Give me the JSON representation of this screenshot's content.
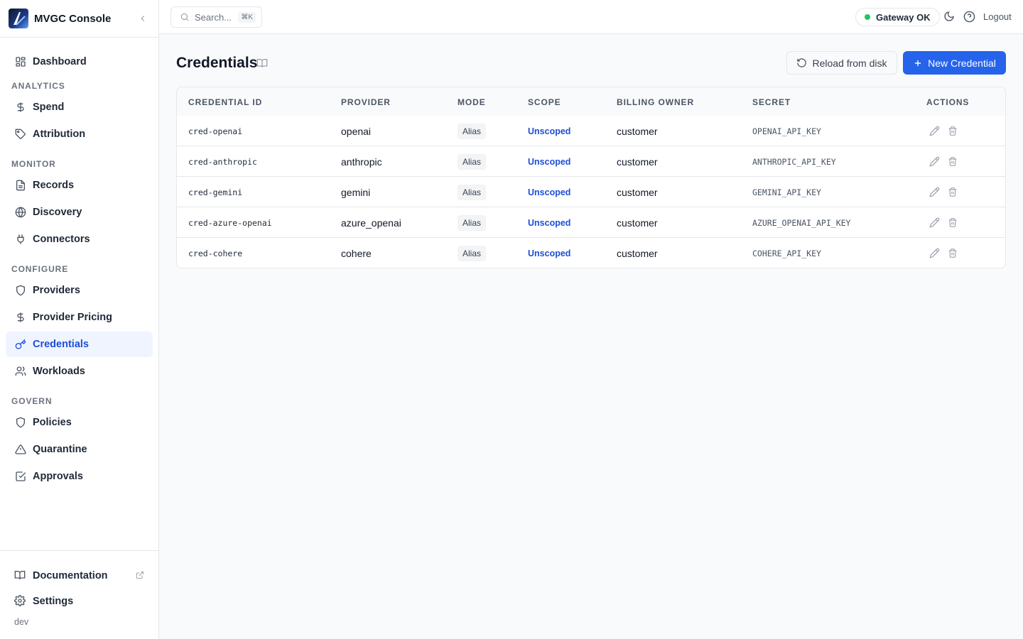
{
  "app": {
    "title": "MVGC Console"
  },
  "sidebar": {
    "dashboard": "Dashboard",
    "sections": {
      "analytics": "ANALYTICS",
      "monitor": "MONITOR",
      "configure": "CONFIGURE",
      "govern": "GOVERN"
    },
    "items": {
      "spend": "Spend",
      "attribution": "Attribution",
      "records": "Records",
      "discovery": "Discovery",
      "connectors": "Connectors",
      "providers": "Providers",
      "provider_pricing": "Provider Pricing",
      "credentials": "Credentials",
      "workloads": "Workloads",
      "policies": "Policies",
      "quarantine": "Quarantine",
      "approvals": "Approvals"
    },
    "active": "credentials",
    "footer": {
      "documentation": "Documentation",
      "settings": "Settings",
      "env": "dev"
    }
  },
  "topbar": {
    "search_placeholder": "Search...",
    "search_shortcut": "⌘K",
    "gateway_status": "Gateway OK",
    "logout": "Logout"
  },
  "page": {
    "title": "Credentials",
    "reload_button": "Reload from disk",
    "new_button": "New Credential"
  },
  "table": {
    "headers": {
      "id": "CREDENTIAL ID",
      "provider": "PROVIDER",
      "mode": "MODE",
      "scope": "SCOPE",
      "billing": "BILLING OWNER",
      "secret": "SECRET",
      "actions": "ACTIONS"
    },
    "rows": [
      {
        "id": "cred-openai",
        "provider": "openai",
        "mode": "Alias",
        "scope": "Unscoped",
        "billing": "customer",
        "secret": "OPENAI_API_KEY"
      },
      {
        "id": "cred-anthropic",
        "provider": "anthropic",
        "mode": "Alias",
        "scope": "Unscoped",
        "billing": "customer",
        "secret": "ANTHROPIC_API_KEY"
      },
      {
        "id": "cred-gemini",
        "provider": "gemini",
        "mode": "Alias",
        "scope": "Unscoped",
        "billing": "customer",
        "secret": "GEMINI_API_KEY"
      },
      {
        "id": "cred-azure-openai",
        "provider": "azure_openai",
        "mode": "Alias",
        "scope": "Unscoped",
        "billing": "customer",
        "secret": "AZURE_OPENAI_API_KEY"
      },
      {
        "id": "cred-cohere",
        "provider": "cohere",
        "mode": "Alias",
        "scope": "Unscoped",
        "billing": "customer",
        "secret": "COHERE_API_KEY"
      }
    ]
  }
}
